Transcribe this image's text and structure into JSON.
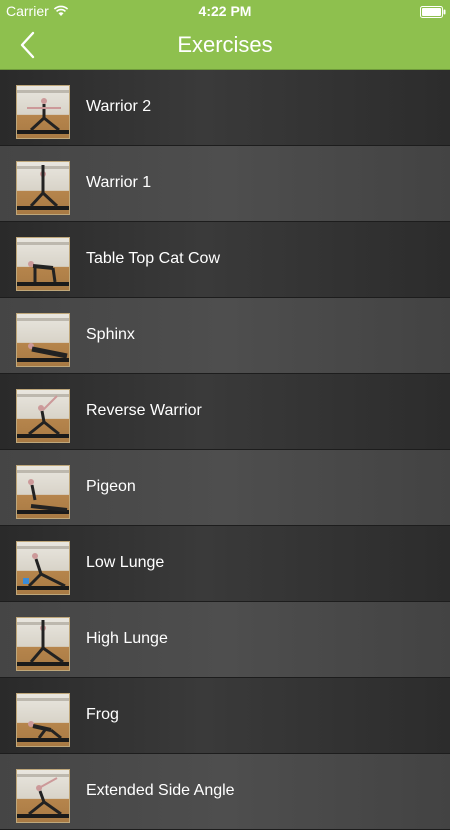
{
  "status_bar": {
    "carrier": "Carrier",
    "time": "4:22 PM"
  },
  "nav": {
    "title": "Exercises",
    "back_icon": "chevron-left-icon"
  },
  "colors": {
    "nav_green": "#8ec04e",
    "text": "#ffffff"
  },
  "exercises": [
    {
      "name": "Warrior 2",
      "pose": "warrior2"
    },
    {
      "name": "Warrior 1",
      "pose": "warrior1"
    },
    {
      "name": "Table Top Cat Cow",
      "pose": "tabletop"
    },
    {
      "name": "Sphinx",
      "pose": "sphinx"
    },
    {
      "name": "Reverse Warrior",
      "pose": "reverse"
    },
    {
      "name": "Pigeon",
      "pose": "pigeon"
    },
    {
      "name": "Low Lunge",
      "pose": "lowlunge"
    },
    {
      "name": "High Lunge",
      "pose": "highlunge"
    },
    {
      "name": "Frog",
      "pose": "frog"
    },
    {
      "name": "Extended Side Angle",
      "pose": "sideangle"
    }
  ]
}
